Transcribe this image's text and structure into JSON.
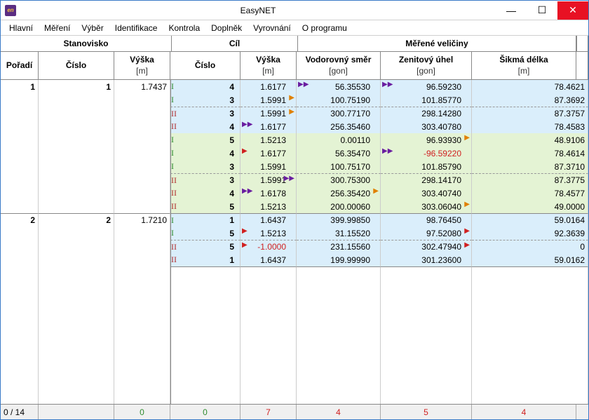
{
  "window": {
    "title": "EasyNET"
  },
  "menu": [
    "Hlavní",
    "Měření",
    "Výběr",
    "Identifikace",
    "Kontrola",
    "Doplněk",
    "Vyrovnání",
    "O programu"
  ],
  "header_groups": {
    "g1": "Stanovisko",
    "g2": "Cíl",
    "g3": "Měřené veličiny"
  },
  "columns": {
    "poradi": "Pořadí",
    "cislo1": "Číslo",
    "vyska1": "Výška",
    "vyska1_u": "[m]",
    "cislo2": "Číslo",
    "vyska2": "Výška",
    "vyska2_u": "[m]",
    "vodo": "Vodorovný směr",
    "vodo_u": "[gon]",
    "zenit": "Zenitový úhel",
    "zenit_u": "[gon]",
    "sikma": "Šikmá délka",
    "sikma_u": "[m]"
  },
  "stations": [
    {
      "poradi": "1",
      "cislo": "1",
      "vyska": "1.7437",
      "groups": [
        {
          "bg": "blue",
          "obs": [
            {
              "mark": "I",
              "mc": "g",
              "cislo": "4",
              "vyska": "1.6177",
              "vodoL": "purple-dbl",
              "vodo": "56.35530",
              "zenitL": "purple-dbl",
              "zenit": "96.59230",
              "sikma": "78.4621"
            },
            {
              "mark": "I",
              "mc": "g",
              "cislo": "3",
              "vyska": "1.5991",
              "vyskaR": "orange",
              "vodo": "100.75190",
              "zenit": "101.85770",
              "sikma": "87.3692"
            },
            {
              "mark": "II",
              "mc": "r",
              "dash": true,
              "cislo": "3",
              "vyska": "1.5991",
              "vyskaR": "orange",
              "vodo": "300.77170",
              "zenit": "298.14280",
              "sikma": "87.3757"
            },
            {
              "mark": "II",
              "mc": "r",
              "cislo": "4",
              "vyska": "1.6177",
              "vyskaL": "purple-dbl",
              "vodo": "256.35460",
              "zenit": "303.40780",
              "sikma": "78.4583"
            }
          ]
        },
        {
          "bg": "green",
          "obs": [
            {
              "mark": "I",
              "mc": "g",
              "cislo": "5",
              "vyska": "1.5213",
              "vodo": "0.00110",
              "zenit": "96.93930",
              "zenitR": "orange",
              "sikma": "48.9106"
            },
            {
              "mark": "I",
              "mc": "g",
              "cislo": "4",
              "vyska": "1.6177",
              "vyskaL": "red",
              "vodo": "56.35470",
              "zenitL": "purple-dbl",
              "zenit": "-96.59220",
              "neg_zenit": true,
              "sikma": "78.4614"
            },
            {
              "mark": "I",
              "mc": "g",
              "cislo": "3",
              "vyska": "1.5991",
              "vodo": "100.75170",
              "zenit": "101.85790",
              "sikma": "87.3710"
            },
            {
              "mark": "II",
              "mc": "r",
              "dash": true,
              "cislo": "3",
              "vyska": "1.5991",
              "vyskaR": "purple-dbl",
              "vodo": "300.75300",
              "zenit": "298.14170",
              "sikma": "87.3775"
            },
            {
              "mark": "II",
              "mc": "r",
              "cislo": "4",
              "vyska": "1.6178",
              "vyskaL": "purple-dbl",
              "vodo": "256.35420",
              "vodoR": "orange",
              "zenit": "303.40740",
              "sikma": "78.4577"
            },
            {
              "mark": "II",
              "mc": "r",
              "cislo": "5",
              "vyska": "1.5213",
              "vodo": "200.00060",
              "zenit": "303.06040",
              "zenitR": "orange",
              "sikma": "49.0000"
            }
          ]
        }
      ]
    },
    {
      "poradi": "2",
      "cislo": "2",
      "vyska": "1.7210",
      "groups": [
        {
          "bg": "blue",
          "obs": [
            {
              "mark": "I",
              "mc": "g",
              "cislo": "1",
              "vyska": "1.6437",
              "vodo": "399.99850",
              "zenit": "98.76450",
              "sikma": "59.0164"
            },
            {
              "mark": "I",
              "mc": "g",
              "cislo": "5",
              "vyska": "1.5213",
              "vyskaL": "red",
              "vodo": "31.15520",
              "zenit": "97.52080",
              "zenitR": "red",
              "sikma": "92.3639"
            },
            {
              "mark": "II",
              "mc": "r",
              "dash": true,
              "cislo": "5",
              "vyska": "-1.0000",
              "neg_vyska": true,
              "vyskaL": "red",
              "vodo": "231.15560",
              "zenit": "302.47940",
              "zenitR": "red",
              "sikma": "0"
            },
            {
              "mark": "II",
              "mc": "r",
              "cislo": "1",
              "vyska": "1.6437",
              "vodo": "199.99990",
              "zenit": "301.23600",
              "sikma": "59.0162"
            }
          ]
        }
      ]
    }
  ],
  "footer": {
    "count": "0 / 14",
    "v": [
      "0",
      "0",
      "7",
      "4",
      "5",
      "4"
    ]
  },
  "footer_colors": [
    "#2e8b2e",
    "#2e8b2e",
    "#d02020",
    "#d02020",
    "#d02020",
    "#d02020"
  ]
}
